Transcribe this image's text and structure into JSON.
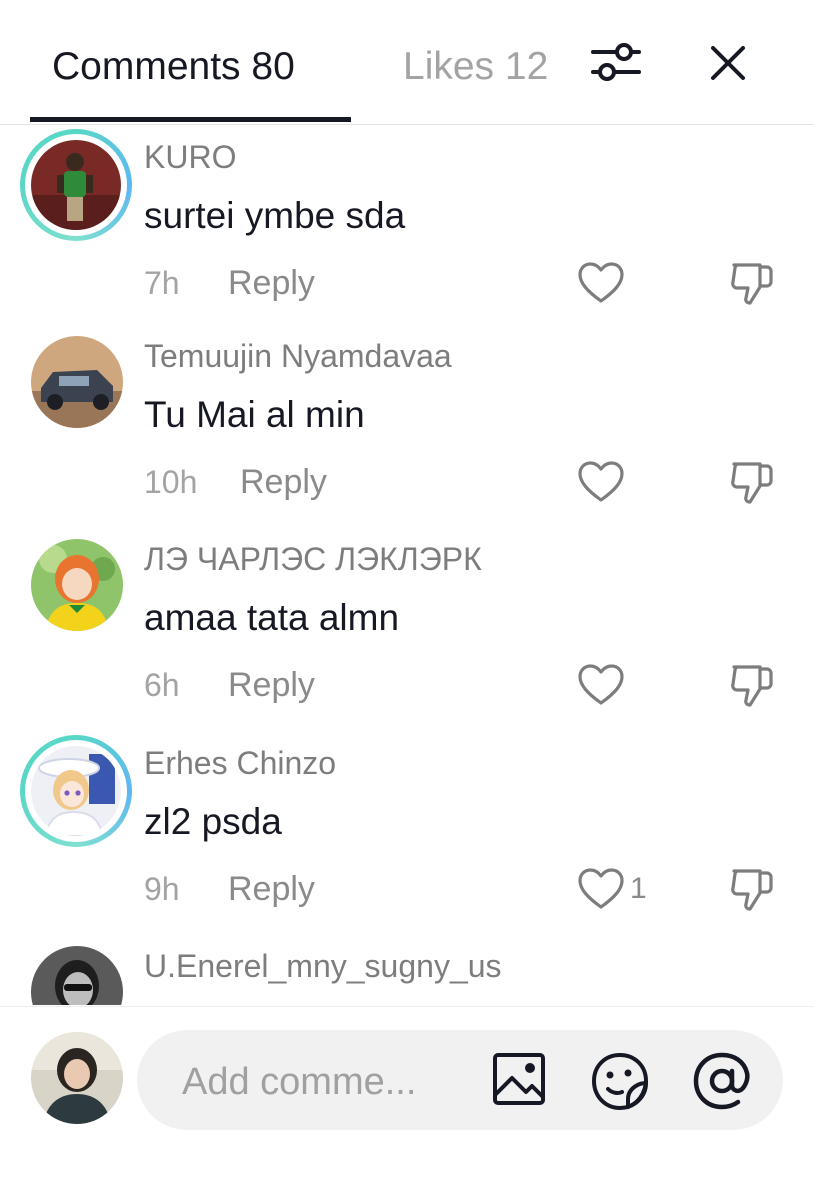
{
  "header": {
    "tab_comments": "Comments 80",
    "tab_likes": "Likes 12",
    "filter_icon": "sliders-icon",
    "close_icon": "close-icon"
  },
  "comments": [
    {
      "username": "KURO",
      "text": "surtei ymbe sda",
      "time": "7h",
      "reply": "Reply",
      "likes": "",
      "story_ring": true
    },
    {
      "username": "Temuujin Nyamdavaa",
      "text": "Tu Mai al min",
      "time": "10h",
      "reply": "Reply",
      "likes": "",
      "story_ring": false
    },
    {
      "username": "ЛЭ ЧАРЛЭС ЛЭКЛЭРК",
      "text": "amaa tata almn",
      "time": "6h",
      "reply": "Reply",
      "likes": "",
      "story_ring": false
    },
    {
      "username": "Erhes Chinzo",
      "text": "zl2 psda",
      "time": "9h",
      "reply": "Reply",
      "likes": "1",
      "story_ring": true
    },
    {
      "username": "U.Enerel_mny_sugny_us",
      "text": "",
      "time": "",
      "reply": "",
      "likes": "",
      "story_ring": false
    }
  ],
  "footer": {
    "placeholder": "Add comme...",
    "icons": [
      "image-icon",
      "emoji-sticker-icon",
      "at-mention-icon"
    ]
  },
  "colors": {
    "primary_text": "#161823",
    "secondary_text": "#8a8a8a",
    "story_ring": "#59d8c8",
    "input_bg": "#f1f1f2"
  }
}
